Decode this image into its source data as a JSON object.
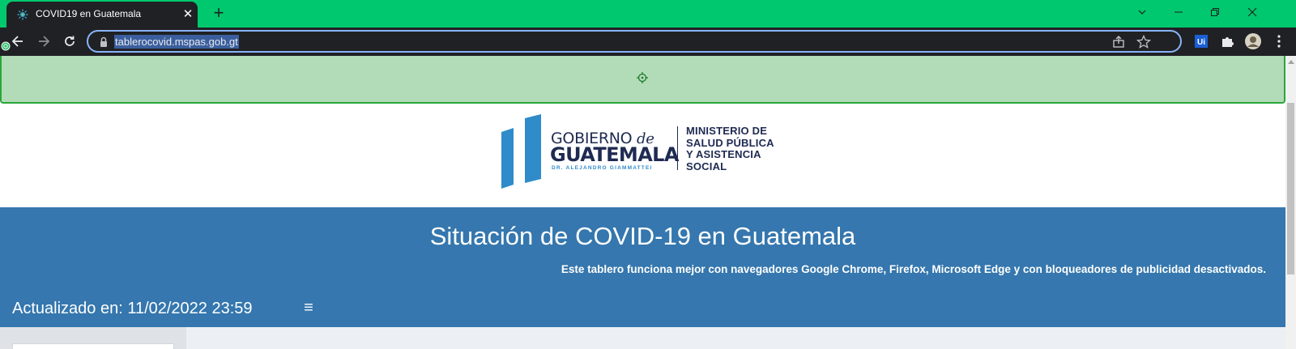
{
  "browser": {
    "tab_title": "COVID19 en Guatemala",
    "tab_close": "✕",
    "new_tab": "+",
    "url": "tablerocovid.mspas.gob.gt"
  },
  "icons": {
    "favicon": "virus-icon",
    "back": "back-arrow-icon",
    "forward": "forward-arrow-icon",
    "reload": "reload-icon",
    "lock": "lock-icon",
    "share": "share-icon",
    "bookmark": "star-icon",
    "extensions": [
      "ui-extension-icon",
      "puzzle-extensions-icon",
      "profile-avatar-icon"
    ],
    "menu": "kebab-menu-icon",
    "crosshair": "crosshair-icon"
  },
  "logo": {
    "gobierno": "GOBIERNO",
    "de": "de",
    "guatemala": "GUATEMALA",
    "president": "DR. ALEJANDRO GIAMMATTEI",
    "ministry_lines": [
      "MINISTERIO DE",
      "SALUD PÚBLICA",
      "Y ASISTENCIA",
      "SOCIAL"
    ]
  },
  "banner": {
    "title": "Situación de COVID-19 en Guatemala",
    "subtitle": "Este tablero funciona mejor con navegadores Google Chrome, Firefox, Microsoft Edge y con bloqueadores de publicidad desactivados.",
    "updated": "Actualizado en: 11/02/2022 23:59",
    "menu_glyph": "≡"
  },
  "colors": {
    "tabstrip": "#00c86e",
    "toolbar": "#202124",
    "overlay": "#b2dbb7",
    "banner": "#3577ae",
    "logo_navy": "#1e2a52",
    "logo_blue": "#2f8bc9"
  }
}
